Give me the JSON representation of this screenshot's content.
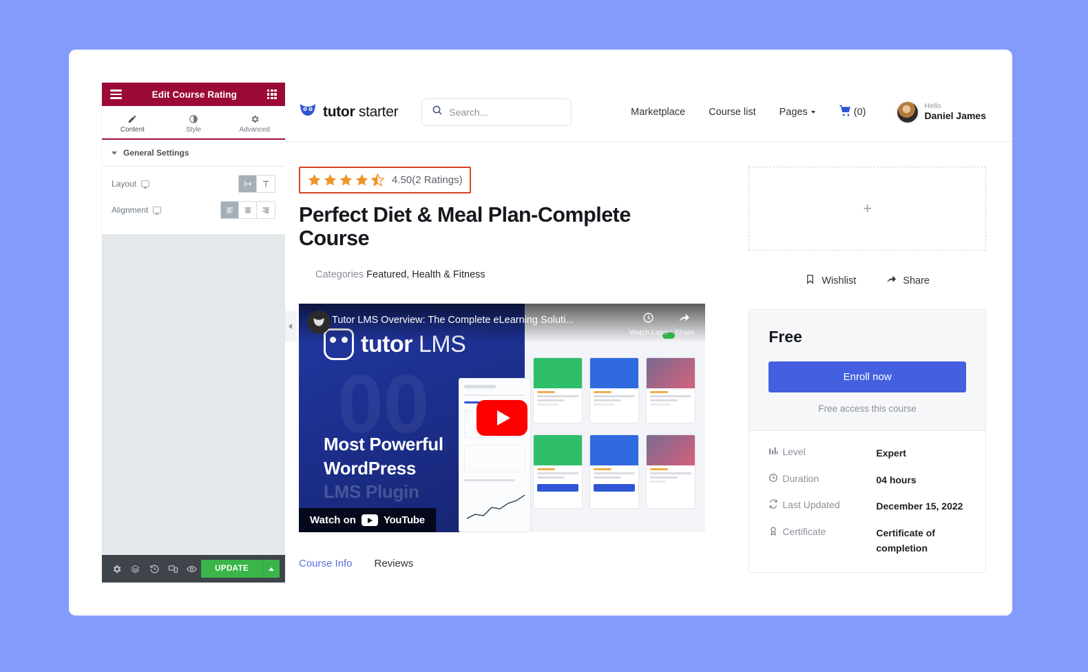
{
  "editor_panel": {
    "header": {
      "title": "Edit Course Rating",
      "menu_icon": "hamburger-icon",
      "grid_icon": "grid-icon"
    },
    "tabs": [
      {
        "label": "Content",
        "icon": "pencil-icon",
        "active": true
      },
      {
        "label": "Style",
        "icon": "contrast-icon",
        "active": false
      },
      {
        "label": "Advanced",
        "icon": "gear-icon",
        "active": false
      }
    ],
    "section": {
      "label": "General Settings"
    },
    "controls": [
      {
        "label": "Layout",
        "responsive_icon": "desktop-icon",
        "options": [
          "layout-inline",
          "layout-stacked"
        ],
        "selected": 0
      },
      {
        "label": "Alignment",
        "responsive_icon": "desktop-icon",
        "options": [
          "align-left",
          "align-center",
          "align-right"
        ],
        "selected": 0
      }
    ],
    "footer": {
      "icons": [
        "settings-icon",
        "layers-icon",
        "history-icon",
        "responsive-icon",
        "preview-icon"
      ],
      "update_label": "UPDATE",
      "update_arrow_icon": "chevron-up-icon"
    },
    "collapse_icon": "chevron-left-icon"
  },
  "site": {
    "brand": {
      "name_bold": "tutor",
      "name_light": " starter",
      "logo_icon": "owl-logo-icon"
    },
    "search": {
      "placeholder": "Search...",
      "value": "",
      "icon": "search-icon"
    },
    "nav": [
      {
        "label": "Marketplace",
        "has_caret": false
      },
      {
        "label": "Course list",
        "has_caret": false
      },
      {
        "label": "Pages",
        "has_caret": true
      }
    ],
    "cart": {
      "icon": "cart-icon",
      "count": "(0)"
    },
    "user": {
      "greeting": "Hello",
      "name": "Daniel James",
      "avatar_icon": "avatar"
    }
  },
  "course": {
    "rating": {
      "value": "4.50",
      "count_text": "(2 Ratings)",
      "stars_filled": 4,
      "stars_half": 1,
      "stars_total": 5,
      "star_color": "#f0932b",
      "highlight_color": "#d9401f"
    },
    "title": "Perfect Diet & Meal Plan-Complete Course",
    "categories_label": "Categories",
    "categories": "Featured, Health & Fitness",
    "video": {
      "title": "Tutor LMS Overview: The Complete eLearning Soluti...",
      "watch_later_label": "Watch Later",
      "watch_later_icon": "clock-icon",
      "share_label": "Share",
      "share_icon": "share-arrow-icon",
      "play_icon": "play-button-icon",
      "watch_on_label": "Watch on",
      "youtube_label": "YouTube",
      "overlay_brand_bold": "tutor",
      "overlay_brand_light": " LMS",
      "tagline_line1": "Most Powerful",
      "tagline_line2": "WordPress",
      "tagline_line3": "LMS Plugin"
    },
    "tabs": [
      {
        "label": "Course Info",
        "active": true
      },
      {
        "label": "Reviews",
        "active": false
      }
    ]
  },
  "sidebar": {
    "placeholder": {
      "plus_icon": "plus-icon"
    },
    "actions": [
      {
        "label": "Wishlist",
        "icon": "bookmark-icon"
      },
      {
        "label": "Share",
        "icon": "share-arrow-icon"
      }
    ],
    "price_card": {
      "price": "Free",
      "enroll_label": "Enroll now",
      "note": "Free access this course",
      "accent_color": "#4460e0",
      "meta": [
        {
          "icon": "level-bars-icon",
          "label": "Level",
          "value": "Expert"
        },
        {
          "icon": "clock-icon",
          "label": "Duration",
          "value": "04 hours"
        },
        {
          "icon": "refresh-icon",
          "label": "Last Updated",
          "value": "December 15, 2022"
        },
        {
          "icon": "certificate-icon",
          "label": "Certificate",
          "value": "Certificate of completion"
        }
      ]
    }
  }
}
